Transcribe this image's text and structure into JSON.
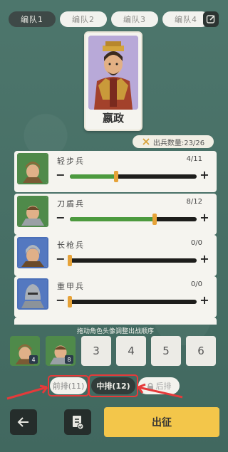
{
  "tabs": [
    {
      "label": "编队1",
      "active": true
    },
    {
      "label": "编队2",
      "active": false
    },
    {
      "label": "编队3",
      "active": false
    },
    {
      "label": "编队4",
      "active": false
    }
  ],
  "general": {
    "name": "嬴政"
  },
  "troop_count": {
    "label": "出兵数量:23/26"
  },
  "units": [
    {
      "name": "轻步兵",
      "count": "4/11",
      "fill": 0.364,
      "color": "green"
    },
    {
      "name": "刀盾兵",
      "count": "8/12",
      "fill": 0.667,
      "color": "green"
    },
    {
      "name": "长枪兵",
      "count": "0/0",
      "fill": 0,
      "color": "blue"
    },
    {
      "name": "重甲兵",
      "count": "0/0",
      "fill": 0,
      "color": "blue"
    }
  ],
  "hint": "拖动角色头像调整出战顺序",
  "slots": [
    {
      "label": "",
      "badge": "4",
      "filled": true
    },
    {
      "label": "",
      "badge": "8",
      "filled": true
    },
    {
      "label": "3",
      "badge": "",
      "filled": false
    },
    {
      "label": "4",
      "badge": "",
      "filled": false
    },
    {
      "label": "5",
      "badge": "",
      "filled": false
    },
    {
      "label": "6",
      "badge": "",
      "filled": false
    }
  ],
  "rows": {
    "front": "前排(11)",
    "middle": "中排(12)",
    "back": "后排"
  },
  "actions": {
    "deploy": "出征"
  },
  "colors": {
    "accent": "#f3c64a",
    "highlight": "#e53a3a",
    "fill": "#4c9a3e"
  }
}
